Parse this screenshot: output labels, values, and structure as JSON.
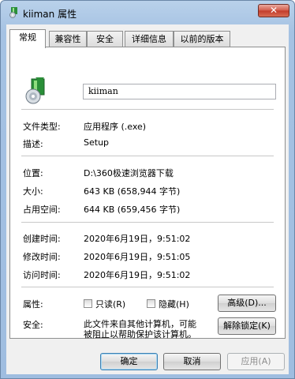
{
  "window": {
    "title": "kiiman 属性",
    "close_label": "✕"
  },
  "tabs": [
    {
      "label": "常规"
    },
    {
      "label": "兼容性"
    },
    {
      "label": "安全"
    },
    {
      "label": "详细信息"
    },
    {
      "label": "以前的版本"
    }
  ],
  "general": {
    "name_value": "kiiman",
    "file_type": {
      "label": "文件类型:",
      "value": "应用程序 (.exe)"
    },
    "description": {
      "label": "描述:",
      "value": "Setup"
    },
    "location": {
      "label": "位置:",
      "value": "D:\\360极速浏览器下载"
    },
    "size": {
      "label": "大小:",
      "value": "643 KB (658,944 字节)"
    },
    "size_on_disk": {
      "label": "占用空间:",
      "value": "644 KB (659,456 字节)"
    },
    "created": {
      "label": "创建时间:",
      "value": "2020年6月19日，9:51:02"
    },
    "modified": {
      "label": "修改时间:",
      "value": "2020年6月19日，9:51:05"
    },
    "accessed": {
      "label": "访问时间:",
      "value": "2020年6月19日，9:51:02"
    },
    "attributes": {
      "label": "属性:",
      "readonly_label": "只读(R)",
      "hidden_label": "隐藏(H)",
      "advanced_label": "高级(D)...",
      "readonly_checked": false,
      "hidden_checked": false
    },
    "security": {
      "label": "安全:",
      "message_line1": "此文件来自其他计算机，可能",
      "message_line2": "被阻止以帮助保护该计算机。",
      "unblock_label": "解除锁定(K)"
    }
  },
  "footer": {
    "ok_label": "确定",
    "cancel_label": "取消",
    "apply_label": "应用(A)"
  },
  "colors": {
    "frame": "#a5c2e3",
    "close": "#c23b2a",
    "panel": "#ffffff"
  }
}
